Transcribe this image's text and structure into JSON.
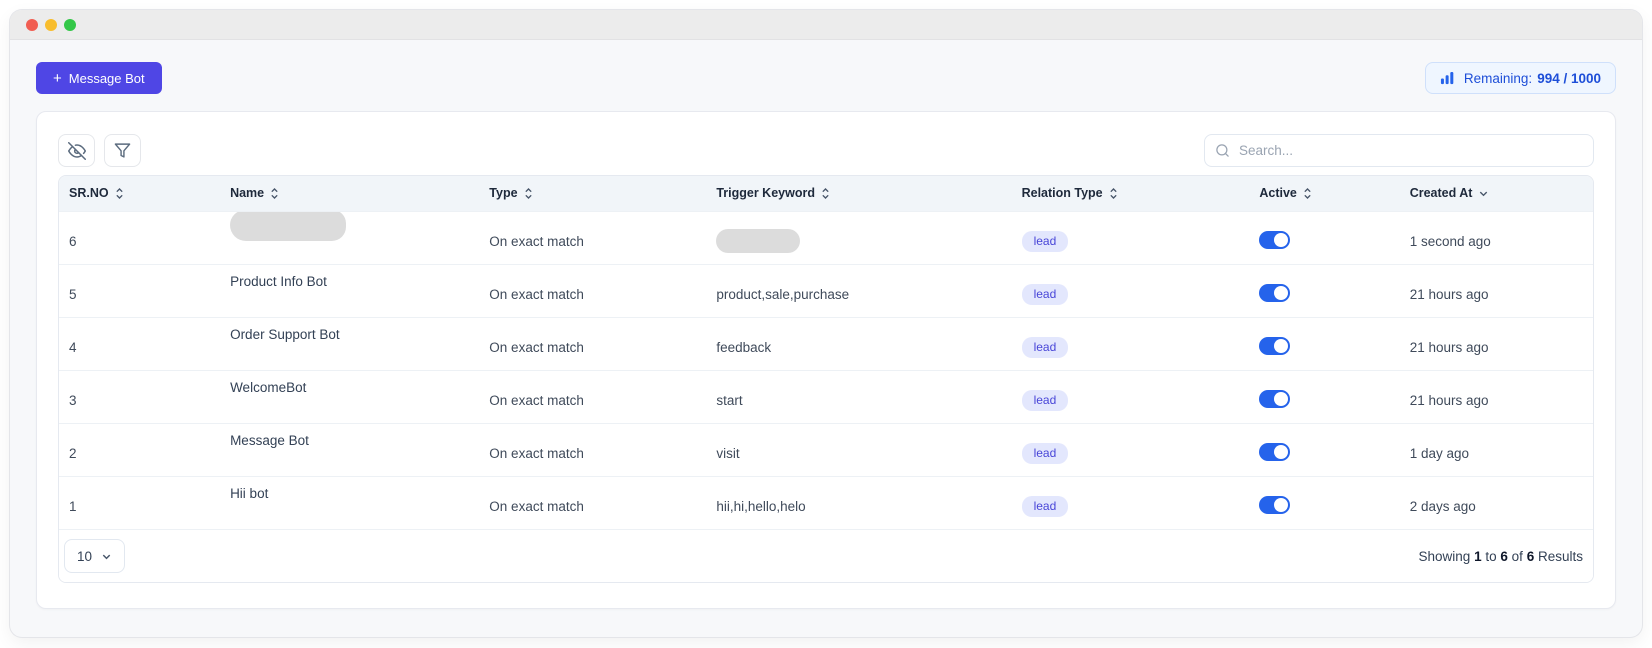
{
  "window": {
    "traffic_lights": [
      "close",
      "minimize",
      "zoom"
    ]
  },
  "topbar": {
    "message_bot_button": {
      "icon": "+",
      "label": "Message Bot"
    },
    "remaining_badge": {
      "label": "Remaining:",
      "value": "994 / 1000"
    }
  },
  "toolbar": {
    "search_placeholder": "Search..."
  },
  "table": {
    "columns": [
      {
        "label": "SR.NO",
        "sort": "both"
      },
      {
        "label": "Name",
        "sort": "both"
      },
      {
        "label": "Type",
        "sort": "both"
      },
      {
        "label": "Trigger Keyword",
        "sort": "both"
      },
      {
        "label": "Relation Type",
        "sort": "both"
      },
      {
        "label": "Active",
        "sort": "both"
      },
      {
        "label": "Created At",
        "sort": "desc"
      }
    ],
    "rows": [
      {
        "sr": "6",
        "name": "",
        "name_redacted": true,
        "type": "On exact match",
        "trigger": "",
        "trigger_redacted": true,
        "relation": "lead",
        "active": true,
        "created": "1 second ago"
      },
      {
        "sr": "5",
        "name": "Product Info Bot",
        "name_redacted": false,
        "type": "On exact match",
        "trigger": "product,sale,purchase",
        "trigger_redacted": false,
        "relation": "lead",
        "active": true,
        "created": "21 hours ago"
      },
      {
        "sr": "4",
        "name": "Order Support Bot",
        "name_redacted": false,
        "type": "On exact match",
        "trigger": "feedback",
        "trigger_redacted": false,
        "relation": "lead",
        "active": true,
        "created": "21 hours ago"
      },
      {
        "sr": "3",
        "name": "WelcomeBot",
        "name_redacted": false,
        "type": "On exact match",
        "trigger": "start",
        "trigger_redacted": false,
        "relation": "lead",
        "active": true,
        "created": "21 hours ago"
      },
      {
        "sr": "2",
        "name": "Message Bot",
        "name_redacted": false,
        "type": "On exact match",
        "trigger": "visit",
        "trigger_redacted": false,
        "relation": "lead",
        "active": true,
        "created": "1 day ago"
      },
      {
        "sr": "1",
        "name": "Hii bot",
        "name_redacted": false,
        "type": "On exact match",
        "trigger": "hii,hi,hello,helo",
        "trigger_redacted": false,
        "relation": "lead",
        "active": true,
        "created": "2 days ago"
      }
    ]
  },
  "footer": {
    "page_size": "10",
    "showing": {
      "prefix": "Showing",
      "start": "1",
      "to_word": "to",
      "end": "6",
      "of_word": "of",
      "total": "6",
      "suffix": "Results"
    }
  },
  "colors": {
    "accent": "#4f46e5",
    "toggle_on": "#2563eb",
    "remaining_text": "#1d4ed8",
    "remaining_bg": "#eff6ff",
    "pill_bg": "#e3e7fd",
    "pill_text": "#4946d8",
    "header_bg": "#f1f5f9"
  }
}
